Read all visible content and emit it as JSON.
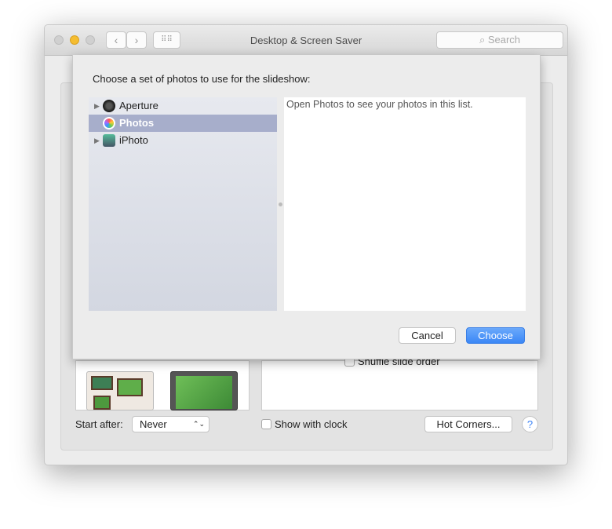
{
  "window": {
    "title": "Desktop & Screen Saver",
    "search_placeholder": "Search"
  },
  "sheet": {
    "prompt": "Choose a set of photos to use for the slideshow:",
    "sources": [
      {
        "label": "Aperture",
        "expandable": true,
        "selected": false,
        "icon": "aperture-icon"
      },
      {
        "label": "Photos",
        "expandable": false,
        "selected": true,
        "icon": "photos-icon"
      },
      {
        "label": "iPhoto",
        "expandable": true,
        "selected": false,
        "icon": "iphoto-icon"
      }
    ],
    "message": "Open Photos to see your photos in this list.",
    "cancel": "Cancel",
    "choose": "Choose"
  },
  "options": {
    "shuffle_label": "Shuffle slide order",
    "shuffle_checked": false
  },
  "footer": {
    "start_after_label": "Start after:",
    "start_after_value": "Never",
    "show_clock_label": "Show with clock",
    "show_clock_checked": false,
    "hot_corners": "Hot Corners...",
    "help": "?"
  },
  "colors": {
    "accent": "#4a90f0",
    "selection": "#a7aecb"
  }
}
